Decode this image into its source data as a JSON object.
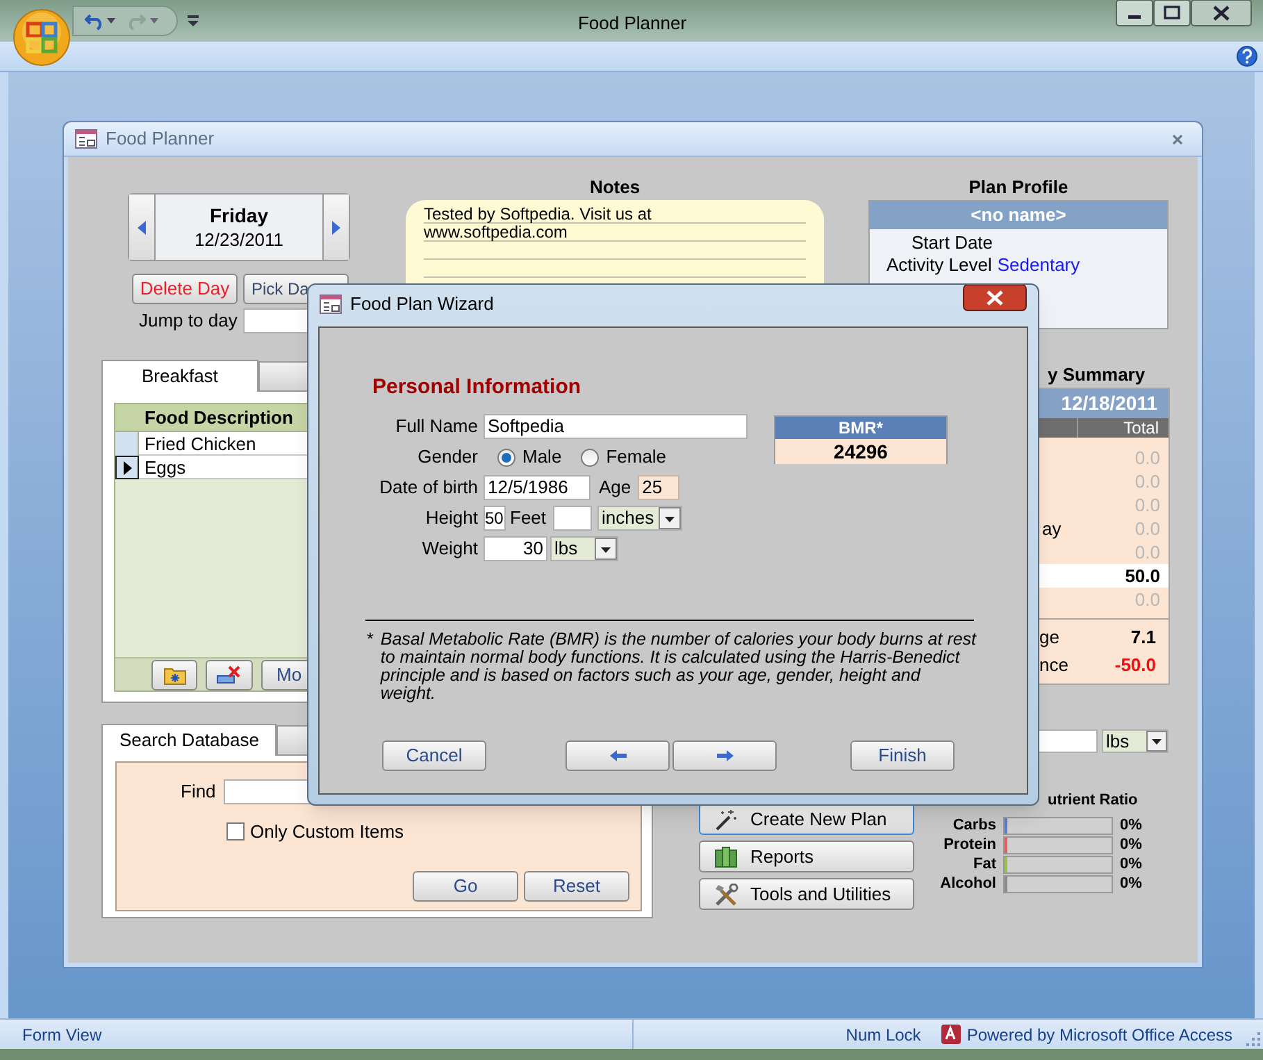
{
  "app": {
    "title": "Food Planner"
  },
  "form": {
    "title": "Food Planner",
    "day_nav": {
      "day": "Friday",
      "date": "12/23/2011"
    },
    "day_buttons": [
      {
        "label": "Delete Day",
        "kind": "danger"
      },
      {
        "label": "Pick Da",
        "kind": "normal"
      }
    ],
    "jump_to_day": {
      "label": "Jump to day"
    },
    "notes": {
      "title": "Notes",
      "lines": [
        "Tested by Softpedia. Visit us at",
        "www.softpedia.com"
      ]
    },
    "plan_profile": {
      "title": "Plan Profile",
      "name": "<no name>",
      "fields": [
        {
          "label": "Start Date"
        },
        {
          "label": "Activity Level",
          "value": "Sedentary"
        }
      ]
    },
    "meal_tabs": [
      {
        "label": "Breakfast",
        "selected": true
      },
      {
        "selected": false
      }
    ],
    "food_grid": {
      "columns": [
        "Food Description"
      ],
      "rows": [
        {
          "cells": [
            "Fried Chicken"
          ],
          "selected": false
        },
        {
          "cells": [
            "Eggs"
          ],
          "selected": true
        }
      ]
    },
    "grid_buttons": [
      {
        "kind": "add"
      },
      {
        "kind": "delete"
      },
      {
        "kind": "text",
        "label": "Mo"
      }
    ],
    "search_tabs": [
      {
        "label": "Search Database",
        "selected": true
      },
      {
        "selected": false
      }
    ],
    "search": {
      "find_label": "Find",
      "only_custom": {
        "label": "Only Custom Items",
        "checked": false
      },
      "buttons": [
        "Go",
        "Reset"
      ]
    },
    "actions": [
      {
        "label": "Create New Plan",
        "kind": "wand",
        "selected": true
      },
      {
        "label": "Reports",
        "kind": "books",
        "selected": false
      },
      {
        "label": "Tools and Utilities",
        "kind": "tools",
        "selected": false
      }
    ],
    "summary": {
      "title": "y Summary",
      "date": "12/18/2011",
      "column": "Total",
      "rows": [
        {
          "value": "0.0",
          "kind": "muted"
        },
        {
          "value": "0.0",
          "kind": "muted"
        },
        {
          "value": "0.0",
          "kind": "muted"
        },
        {
          "label": "ay",
          "value": "0.0",
          "kind": "muted"
        },
        {
          "value": "0.0",
          "kind": "muted"
        },
        {
          "value": "50.0",
          "kind": "highlight"
        },
        {
          "value": "0.0",
          "kind": "muted"
        }
      ],
      "footer": [
        {
          "label": "ge",
          "value": "7.1",
          "kind": "normal"
        },
        {
          "label": "nce",
          "value": "-50.0",
          "kind": "negative"
        }
      ]
    },
    "weight_unit": "lbs",
    "nutrient_ratio": {
      "title": "utrient Ratio",
      "items": [
        {
          "label": "Carbs",
          "level": 0,
          "value": "0%",
          "color": "#5a7ec8"
        },
        {
          "label": "Protein",
          "level": 0,
          "value": "0%",
          "color": "#e06060"
        },
        {
          "label": "Fat",
          "level": 0,
          "value": "0%",
          "color": "#98c050"
        },
        {
          "label": "Alcohol",
          "level": 0,
          "value": "0%",
          "color": "#8c8c8c"
        }
      ]
    }
  },
  "wizard": {
    "title": "Food Plan Wizard",
    "heading": "Personal Information",
    "full_name": {
      "label": "Full Name",
      "value": "Softpedia"
    },
    "gender": {
      "label": "Gender",
      "options": [
        {
          "label": "Male",
          "selected": true
        },
        {
          "label": "Female",
          "selected": false
        }
      ]
    },
    "dob": {
      "label": "Date of birth",
      "value": "12/5/1986"
    },
    "age": {
      "label": "Age",
      "value": "25"
    },
    "height": {
      "label": "Height",
      "feet": "50",
      "feet_label": "Feet",
      "unit": "inches"
    },
    "weight": {
      "label": "Weight",
      "value": "30",
      "unit": "lbs"
    },
    "bmr": {
      "label": "BMR*",
      "value": "24296"
    },
    "footnote_mark": "*",
    "footnote": "Basal Metabolic Rate (BMR) is the number of calories your body burns at rest to maintain normal body functions. It is calculated using the Harris-Benedict principle and is based on factors such as your age, gender, height and weight.",
    "buttons": [
      {
        "kind": "text",
        "label": "Cancel"
      },
      {
        "kind": "back"
      },
      {
        "kind": "next"
      },
      {
        "kind": "text",
        "label": "Finish"
      }
    ]
  },
  "status_bar": {
    "view": "Form View",
    "indicators": [
      "Num Lock"
    ],
    "brand": "Powered by Microsoft Office Access"
  }
}
